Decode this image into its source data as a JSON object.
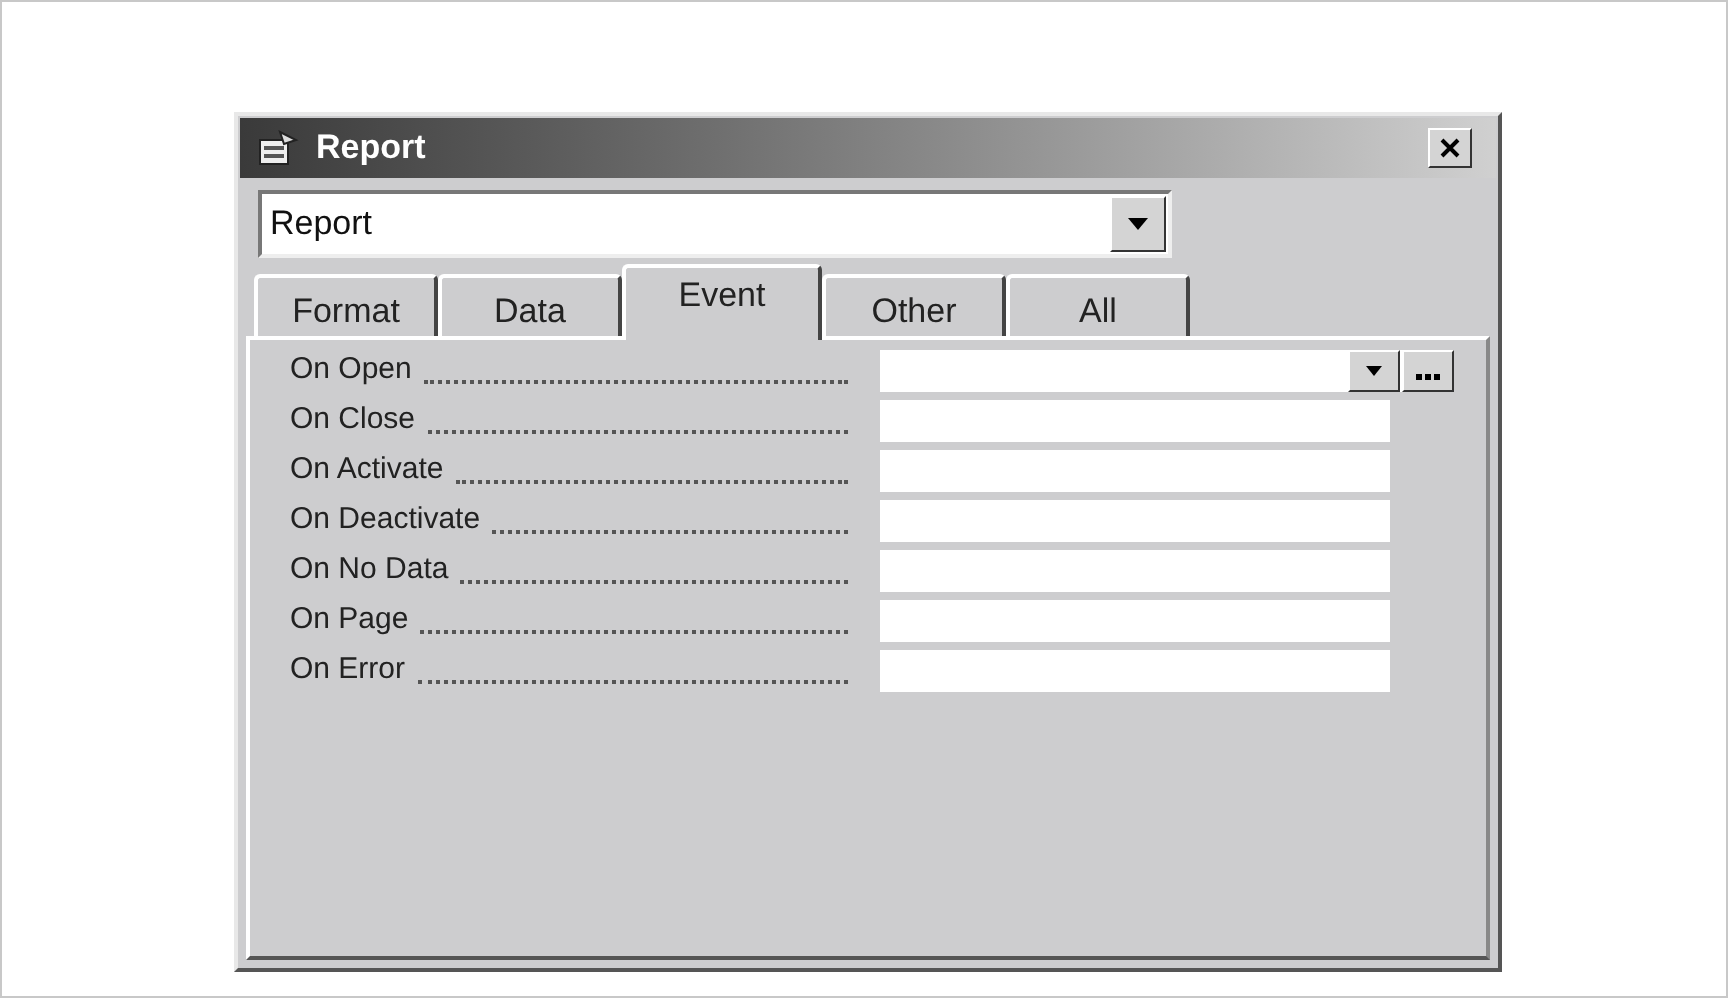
{
  "window": {
    "title": "Report"
  },
  "object_selector": {
    "value": "Report"
  },
  "tabs": [
    {
      "label": "Format",
      "selected": false
    },
    {
      "label": "Data",
      "selected": false
    },
    {
      "label": "Event",
      "selected": true
    },
    {
      "label": "Other",
      "selected": false
    },
    {
      "label": "All",
      "selected": false
    }
  ],
  "properties": [
    {
      "label": "On Open",
      "focused": true
    },
    {
      "label": "On Close",
      "focused": false
    },
    {
      "label": "On Activate",
      "focused": false
    },
    {
      "label": "On Deactivate",
      "focused": false
    },
    {
      "label": "On No Data",
      "focused": false
    },
    {
      "label": "On Page",
      "focused": false
    },
    {
      "label": "On Error",
      "focused": false
    }
  ]
}
